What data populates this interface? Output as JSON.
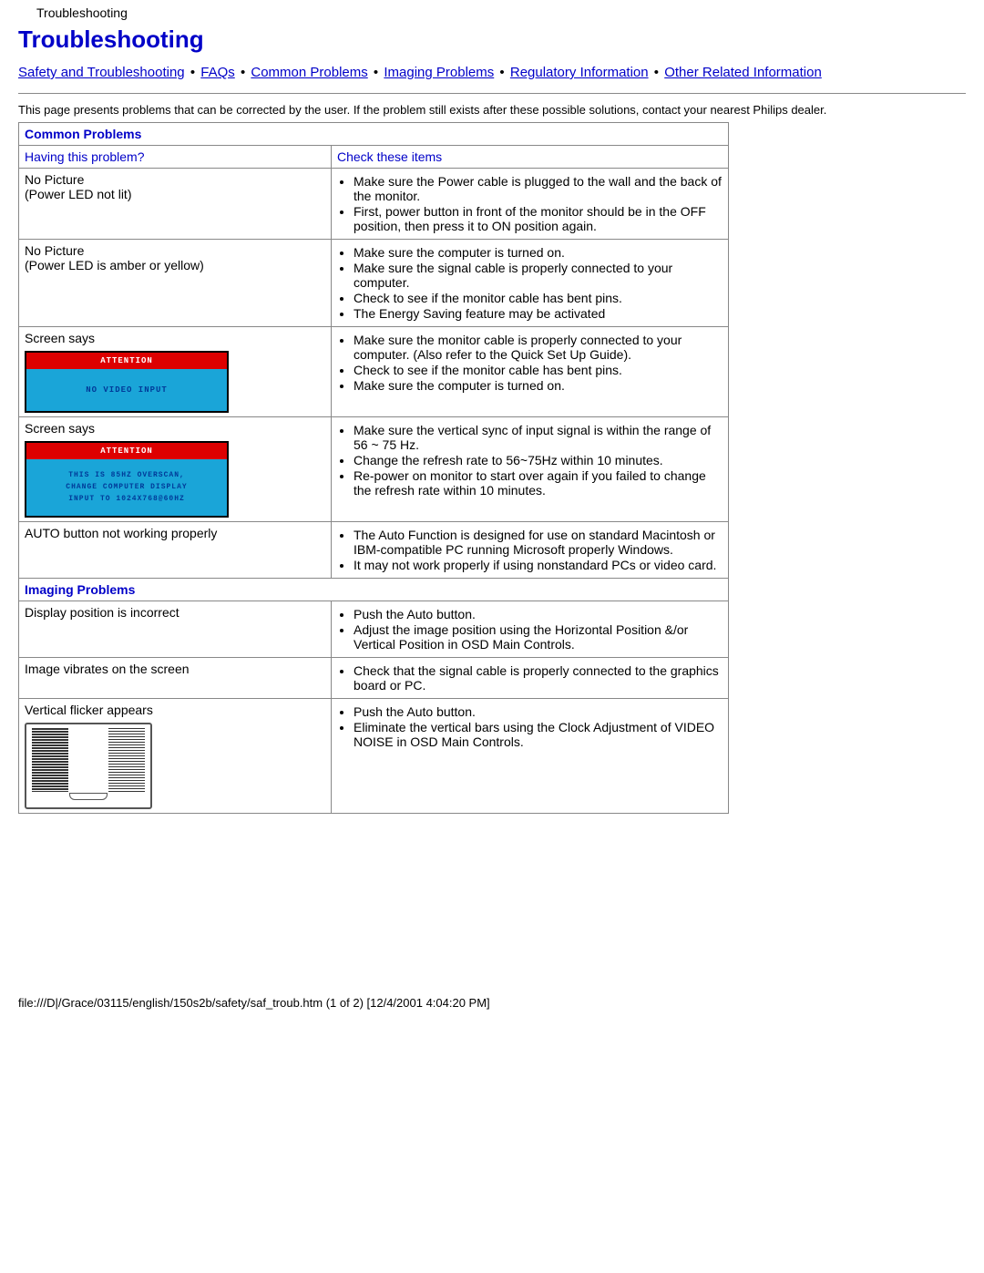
{
  "header_small": "Troubleshooting",
  "page_title": "Troubleshooting",
  "nav": {
    "links": [
      "Safety and Troubleshooting",
      "FAQs",
      "Common Problems",
      "Imaging Problems",
      "Regulatory Information",
      "Other Related Information"
    ],
    "sep": "•"
  },
  "intro": "This page presents problems that can be corrected by the user. If the problem still exists after these possible solutions, contact your nearest Philips dealer.",
  "sections": {
    "common_problems": "Common Problems",
    "imaging_problems": "Imaging Problems",
    "having_problem": "Having this problem?",
    "check_items": "Check these items"
  },
  "osd": {
    "attention": "ATTENTION",
    "no_video": "NO VIDEO INPUT",
    "overscan1": "THIS IS 85HZ OVERSCAN,",
    "overscan2": "CHANGE COMPUTER DISPLAY",
    "overscan3": "INPUT TO 1024X768@60HZ"
  },
  "rows": {
    "r1": {
      "p1": "No Picture",
      "p2": "(Power LED not lit)",
      "c1": "Make sure the Power cable is plugged to the wall and the back of the monitor.",
      "c2": "First, power button in front of the monitor should be in the OFF position, then press it to ON position again."
    },
    "r2": {
      "p1": "No Picture",
      "p2": "(Power LED is amber or yellow)",
      "c1": "Make sure the computer is turned on.",
      "c2": "Make sure the signal cable is properly connected to your computer.",
      "c3": "Check to see if the monitor cable has bent pins.",
      "c4": "The Energy Saving feature may be activated"
    },
    "r3": {
      "p1": "Screen says",
      "c1": "Make sure the monitor cable is properly connected to your computer. (Also refer to the Quick Set Up Guide).",
      "c2": "Check to see if the monitor cable has bent pins.",
      "c3": "Make sure the computer is turned on."
    },
    "r4": {
      "p1": "Screen says",
      "c1": "Make sure the vertical sync of input signal is within the range of 56 ~ 75 Hz.",
      "c2": "Change the refresh rate to 56~75Hz within 10 minutes.",
      "c3": "Re-power on monitor to start over again if you failed to change the refresh rate within 10 minutes."
    },
    "r5": {
      "p1": "AUTO button not working properly",
      "c1": "The Auto Function is designed for use on standard Macintosh or IBM-compatible PC running Microsoft properly Windows.",
      "c2": "It may not work properly if using nonstandard PCs or video card."
    },
    "r6": {
      "p1": "Display position is incorrect",
      "c1": "Push the Auto button.",
      "c2": "Adjust the image position using the Horizontal Position &/or Vertical Position in OSD Main Controls."
    },
    "r7": {
      "p1": "Image vibrates on the screen",
      "c1": "Check that the signal cable is properly connected to the graphics board or PC."
    },
    "r8": {
      "p1": "Vertical flicker appears",
      "c1": "Push the Auto button.",
      "c2": "Eliminate the vertical bars using the Clock Adjustment of VIDEO NOISE in OSD Main Controls."
    }
  },
  "footer": "file:///D|/Grace/03115/english/150s2b/safety/saf_troub.htm (1 of 2) [12/4/2001 4:04:20 PM]"
}
